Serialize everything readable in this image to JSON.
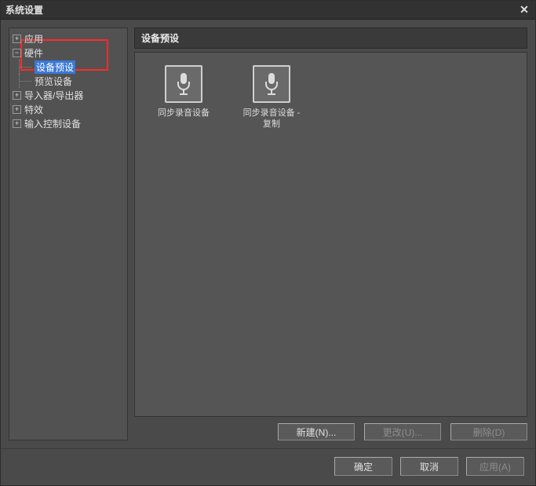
{
  "titlebar": {
    "title": "系统设置",
    "close_glyph": "✕"
  },
  "tree": {
    "items": [
      {
        "label": "应用",
        "toggle": "+"
      },
      {
        "label": "硬件",
        "toggle": "−"
      },
      {
        "label": "设备预设",
        "child": true,
        "selected": true
      },
      {
        "label": "预览设备",
        "child": true
      },
      {
        "label": "导入器/导出器",
        "toggle": "+"
      },
      {
        "label": "特效",
        "toggle": "+"
      },
      {
        "label": "输入控制设备",
        "toggle": "+"
      }
    ]
  },
  "content": {
    "header": "设备预设",
    "devices": [
      {
        "label": "同步录音设备"
      },
      {
        "label": "同步录音设备 - 复制"
      }
    ],
    "buttons": {
      "new": "新建(N)...",
      "change": "更改(U)...",
      "delete": "删除(D)"
    }
  },
  "dialog": {
    "ok": "确定",
    "cancel": "取消",
    "apply": "应用(A)"
  }
}
